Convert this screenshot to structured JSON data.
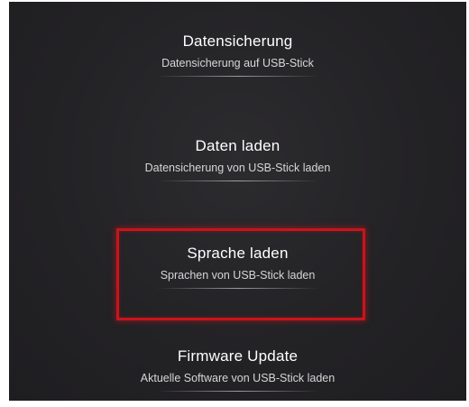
{
  "menu": {
    "items": [
      {
        "title": "Datensicherung",
        "subtitle": "Datensicherung auf USB-Stick",
        "selected": false
      },
      {
        "title": "Daten laden",
        "subtitle": "Datensicherung von USB-Stick laden",
        "selected": false
      },
      {
        "title": "Sprache laden",
        "subtitle": "Sprachen von USB-Stick laden",
        "selected": true
      },
      {
        "title": "Firmware Update",
        "subtitle": "Aktuelle Software von USB-Stick laden",
        "selected": false
      }
    ]
  },
  "colors": {
    "background": "#232225",
    "selection": "#c8141c",
    "text": "#ffffff",
    "subtext": "#d6d6d6"
  }
}
